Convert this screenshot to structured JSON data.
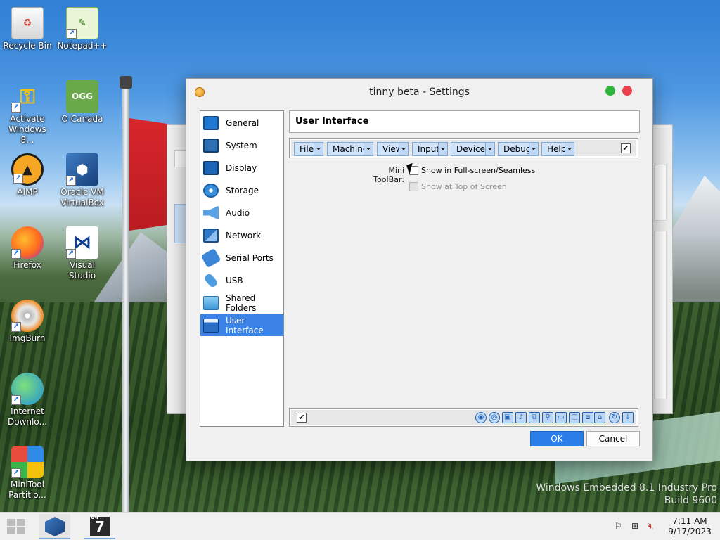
{
  "desktop": {
    "icons": [
      {
        "label": "Recycle Bin"
      },
      {
        "label": "Notepad++"
      },
      {
        "label": "Activate Windows 8..."
      },
      {
        "label": "O Canada",
        "glyph_text": "OGG"
      },
      {
        "label": "AIMP"
      },
      {
        "label": "Oracle VM VirtualBox"
      },
      {
        "label": "Firefox"
      },
      {
        "label": "Visual Studio"
      },
      {
        "label": "ImgBurn"
      },
      {
        "label": "Internet Downlo..."
      },
      {
        "label": "MiniTool Partitio..."
      }
    ],
    "watermark": {
      "line1": "Windows Embedded 8.1 Industry Pro",
      "line2": "Build 9600"
    }
  },
  "dialog": {
    "title": "tinny beta - Settings",
    "nav": [
      {
        "label": "General",
        "icon": "general-icon",
        "color": "#1f78d1"
      },
      {
        "label": "System",
        "icon": "system-icon",
        "color": "#2c6fb3"
      },
      {
        "label": "Display",
        "icon": "display-icon",
        "color": "#1b63b7"
      },
      {
        "label": "Storage",
        "icon": "storage-icon",
        "color": "#3a8fdc"
      },
      {
        "label": "Audio",
        "icon": "audio-icon",
        "color": "#5aa2e6"
      },
      {
        "label": "Network",
        "icon": "network-icon",
        "color": "#2e79c9"
      },
      {
        "label": "Serial Ports",
        "icon": "serial-ports-icon",
        "color": "#3b86d6"
      },
      {
        "label": "USB",
        "icon": "usb-icon",
        "color": "#4f9be0"
      },
      {
        "label": "Shared Folders",
        "icon": "shared-folders-icon",
        "color": "#5fb0ea"
      },
      {
        "label": "User Interface",
        "icon": "user-interface-icon",
        "color": "#2b6fc5",
        "selected": true
      }
    ],
    "page_title": "User Interface",
    "menubar": {
      "menus": [
        "File",
        "Machine",
        "View",
        "Input",
        "Devices",
        "Debug",
        "Help"
      ],
      "enabled_mark": "✔"
    },
    "mini_toolbar": {
      "label": "Mini ToolBar:",
      "show_fullscreen": "Show in Full-screen/Seamless",
      "show_top": "Show at Top of Screen"
    },
    "statusbar": {
      "enabled_mark": "✔",
      "icons": [
        "hard-disk-icon",
        "optical-drive-icon",
        "floppy-icon",
        "audio-icon",
        "network-icon",
        "usb-icon",
        "shared-folders-icon",
        "display-icon",
        "recording-icon",
        "mouse-integration-icon",
        "cpu-icon",
        "keyboard-icon"
      ]
    },
    "ok_label": "OK",
    "cancel_label": "Cancel"
  },
  "taskbar": {
    "time": "7:11 AM",
    "date": "9/17/2023",
    "seven_badge": "7",
    "seven_sub": "64"
  },
  "colors": {
    "accent": "#3b83e6",
    "ok_button": "#2b7de9"
  }
}
